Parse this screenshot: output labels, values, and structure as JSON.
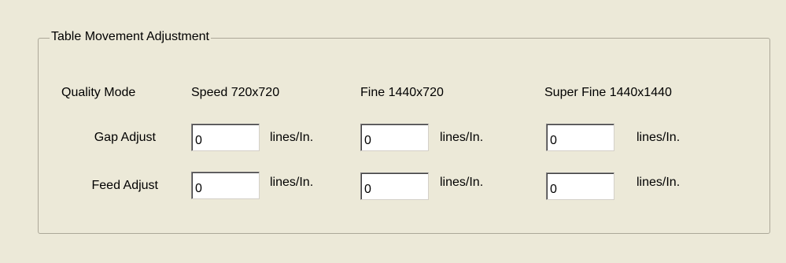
{
  "group": {
    "title": "Table Movement Adjustment"
  },
  "header": {
    "quality_mode_label": "Quality Mode",
    "col_speed": "Speed 720x720",
    "col_fine": "Fine 1440x720",
    "col_superfine": "Super Fine 1440x1440"
  },
  "rows": [
    {
      "label": "Gap Adjust",
      "speed": {
        "value": "0",
        "unit": "lines/In."
      },
      "fine": {
        "value": "0",
        "unit": "lines/In."
      },
      "superfine": {
        "value": "0",
        "unit": "lines/In."
      }
    },
    {
      "label": "Feed Adjust",
      "speed": {
        "value": "0",
        "unit": "lines/In."
      },
      "fine": {
        "value": "0",
        "unit": "lines/In."
      },
      "superfine": {
        "value": "0",
        "unit": "lines/In."
      }
    }
  ]
}
